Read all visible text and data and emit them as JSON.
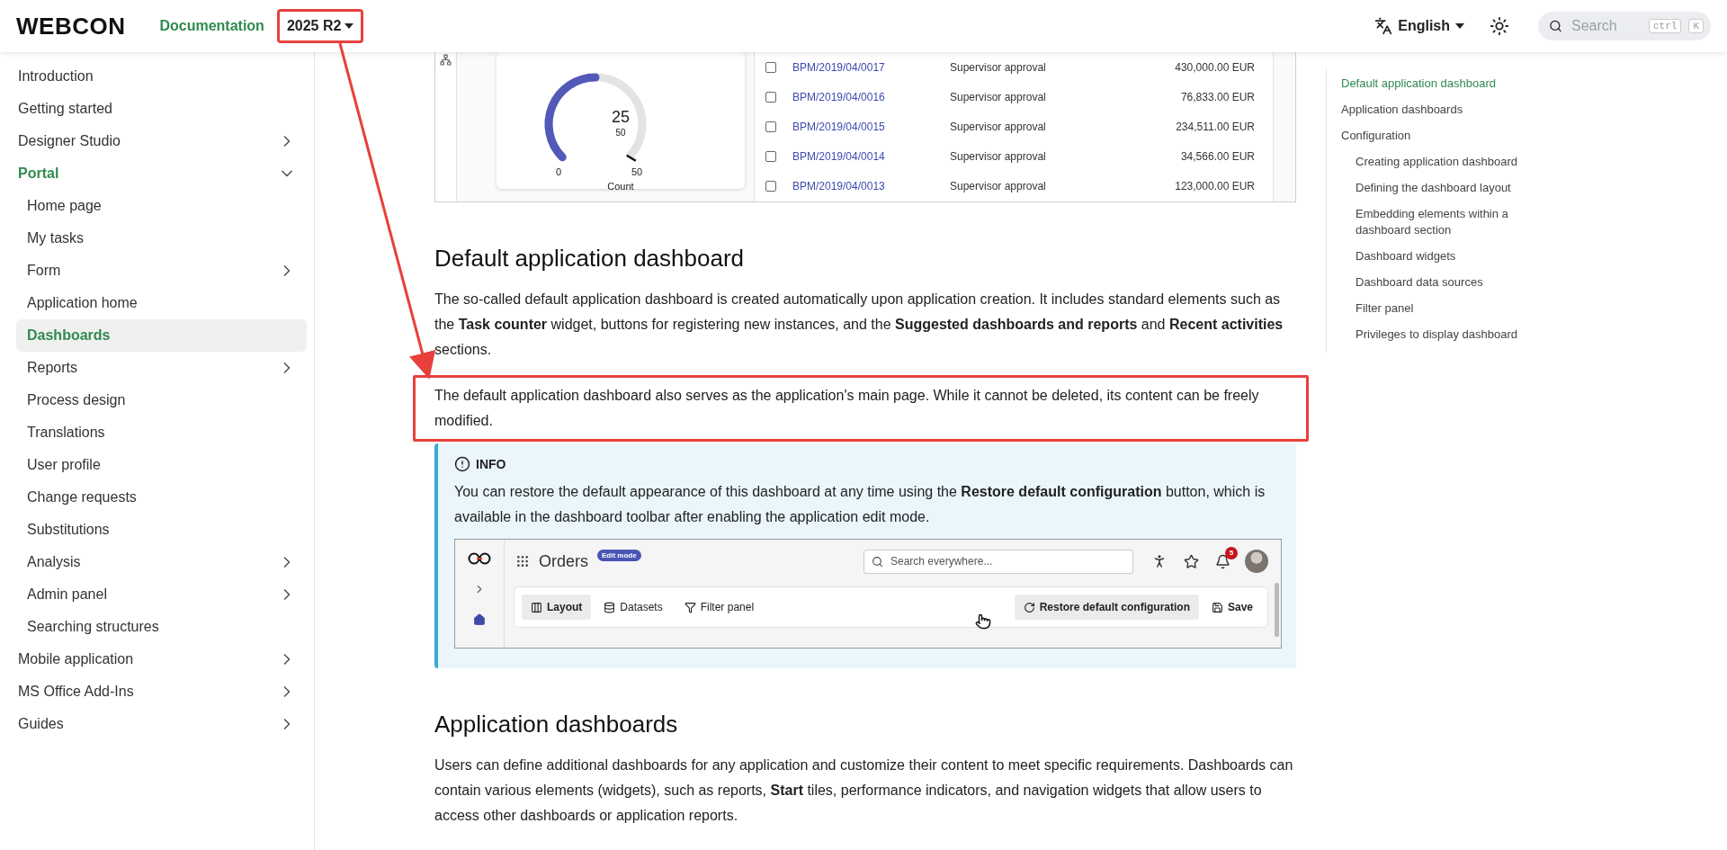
{
  "header": {
    "logo": "WEBCON",
    "nav_link": "Documentation",
    "version": {
      "label": "2025 R2",
      "highlighted": true
    },
    "language": "English",
    "search": {
      "placeholder": "Search",
      "keys": [
        "ctrl",
        "K"
      ]
    }
  },
  "sidebar": {
    "items": [
      {
        "label": "Introduction",
        "kind": "page",
        "selected": false
      },
      {
        "label": "Getting started",
        "kind": "page",
        "selected": false
      },
      {
        "label": "Designer Studio",
        "kind": "group",
        "expanded": false,
        "selected": false
      },
      {
        "label": "Portal",
        "kind": "group",
        "expanded": true,
        "selected": false,
        "children": [
          {
            "label": "Home page",
            "kind": "page",
            "selected": false
          },
          {
            "label": "My tasks",
            "kind": "page",
            "selected": false
          },
          {
            "label": "Form",
            "kind": "group",
            "expanded": false,
            "selected": false
          },
          {
            "label": "Application home",
            "kind": "page",
            "selected": false
          },
          {
            "label": "Dashboards",
            "kind": "page",
            "selected": true
          },
          {
            "label": "Reports",
            "kind": "group",
            "expanded": false,
            "selected": false
          },
          {
            "label": "Process design",
            "kind": "page",
            "selected": false
          },
          {
            "label": "Translations",
            "kind": "page",
            "selected": false
          },
          {
            "label": "User profile",
            "kind": "page",
            "selected": false
          },
          {
            "label": "Change requests",
            "kind": "page",
            "selected": false
          },
          {
            "label": "Substitutions",
            "kind": "page",
            "selected": false
          },
          {
            "label": "Analysis",
            "kind": "group",
            "expanded": false,
            "selected": false
          },
          {
            "label": "Admin panel",
            "kind": "group",
            "expanded": false,
            "selected": false
          },
          {
            "label": "Searching structures",
            "kind": "page",
            "selected": false
          }
        ]
      },
      {
        "label": "Mobile application",
        "kind": "group",
        "expanded": false,
        "selected": false
      },
      {
        "label": "MS Office Add-Ins",
        "kind": "group",
        "expanded": false,
        "selected": false
      },
      {
        "label": "Guides",
        "kind": "group",
        "expanded": false,
        "selected": false
      }
    ]
  },
  "top_figure": {
    "gauge": {
      "value": "25",
      "target": "50",
      "min": "0",
      "max": "50",
      "label": "Count",
      "level": 0.5
    },
    "rows": [
      {
        "id": "BPM/2019/04/0017",
        "step": "Supervisor approval",
        "amount": "430,000.00 EUR",
        "checked": false
      },
      {
        "id": "BPM/2019/04/0016",
        "step": "Supervisor approval",
        "amount": "76,833.00 EUR",
        "checked": false
      },
      {
        "id": "BPM/2019/04/0015",
        "step": "Supervisor approval",
        "amount": "234,511.00 EUR",
        "checked": false
      },
      {
        "id": "BPM/2019/04/0014",
        "step": "Supervisor approval",
        "amount": "34,566.00 EUR",
        "checked": false
      },
      {
        "id": "BPM/2019/04/0013",
        "step": "Supervisor approval",
        "amount": "123,000.00 EUR",
        "checked": false
      }
    ]
  },
  "sections": [
    {
      "heading": "Default application dashboard",
      "blocks": [
        {
          "kind": "paragraph",
          "highlighted": false,
          "text": "The so-called default application dashboard is created automatically upon application creation. It includes standard elements such as the **Task counter** widget, buttons for registering new instances, and the **Suggested dashboards and reports** and **Recent activities** sections."
        },
        {
          "kind": "paragraph",
          "highlighted": true,
          "text": "The default application dashboard also serves as the application's main page. While it cannot be deleted, its content can be freely modified."
        },
        {
          "kind": "info",
          "title": "INFO",
          "text": "You can restore the default appearance of this dashboard at any time using the **Restore default configuration** button, which is available in the dashboard toolbar after enabling the application edit mode.",
          "figure": {
            "app_title": "Orders",
            "badge": "Edit mode",
            "search_placeholder": "Search everywhere...",
            "notifications": "5",
            "toolbar": [
              {
                "label": "Layout",
                "selected": true
              },
              {
                "label": "Datasets",
                "selected": false
              },
              {
                "label": "Filter panel",
                "selected": false
              }
            ],
            "actions": [
              {
                "label": "Restore default configuration",
                "hovered": true
              },
              {
                "label": "Save",
                "hovered": false
              }
            ]
          }
        }
      ]
    },
    {
      "heading": "Application dashboards",
      "blocks": [
        {
          "kind": "paragraph",
          "highlighted": false,
          "text": "Users can define additional dashboards for any application and customize their content to meet specific requirements. Dashboards can contain various elements (widgets), such as reports, **Start** tiles, performance indicators, and navigation widgets that allow users to access other dashboards or application reports."
        }
      ]
    }
  ],
  "toc": {
    "items": [
      {
        "label": "Default application dashboard",
        "selected": true
      },
      {
        "label": "Application dashboards",
        "selected": false
      },
      {
        "label": "Configuration",
        "selected": false,
        "children": [
          {
            "label": "Creating application dashboard",
            "selected": false
          },
          {
            "label": "Defining the dashboard layout",
            "selected": false
          },
          {
            "label": "Embedding elements within a dashboard section",
            "selected": false
          },
          {
            "label": "Dashboard widgets",
            "selected": false
          },
          {
            "label": "Dashboard data sources",
            "selected": false
          },
          {
            "label": "Filter panel",
            "selected": false
          },
          {
            "label": "Privileges to display dashboard",
            "selected": false
          }
        ]
      }
    ]
  }
}
